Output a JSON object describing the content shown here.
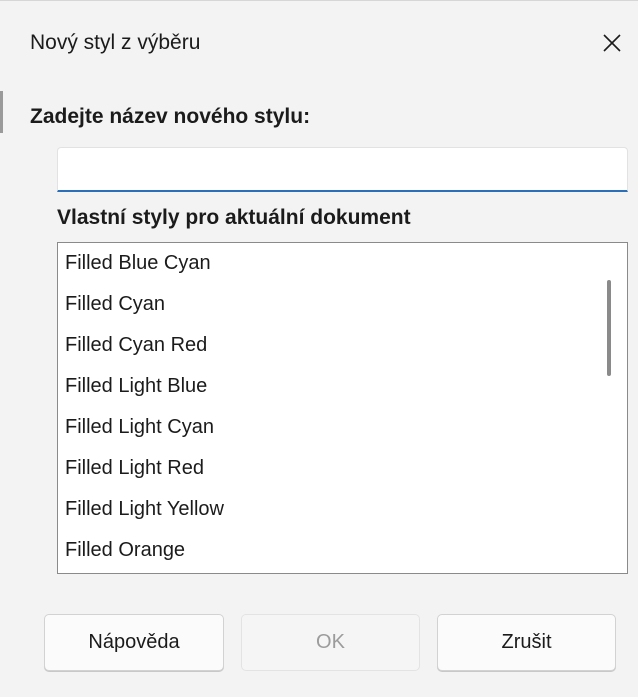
{
  "dialog": {
    "title": "Nový styl z výběru",
    "close_icon": "close-icon"
  },
  "form": {
    "prompt_label": "Zadejte název nového stylu:",
    "name_input": {
      "value": "",
      "placeholder": ""
    },
    "list_label": "Vlastní styly pro aktuální dokument",
    "styles": [
      "Filled Blue Cyan",
      "Filled Cyan",
      "Filled Cyan Red",
      "Filled Light Blue",
      "Filled Light Cyan",
      "Filled Light Red",
      "Filled Light Yellow",
      "Filled Orange"
    ],
    "scroll_position": 0.15
  },
  "buttons": {
    "help": "Nápověda",
    "ok": "OK",
    "cancel": "Zrušit",
    "ok_enabled": false
  },
  "colors": {
    "accent": "#2a6fb8",
    "background": "#f3f3f3",
    "disabled_text": "#9c9c9c"
  }
}
